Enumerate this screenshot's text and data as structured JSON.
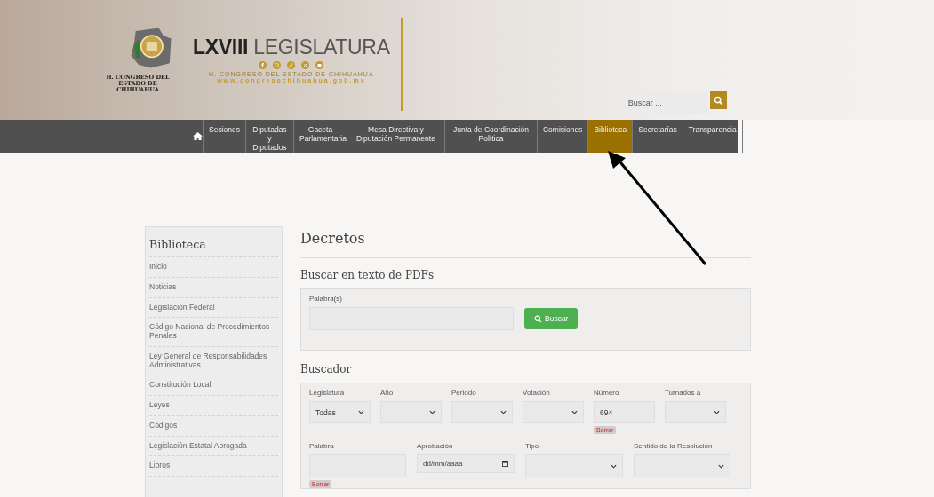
{
  "header": {
    "logo_caption": "H. CONGRESO DEL ESTADO DE CHIHUAHUA",
    "title_bold": "LXVIII",
    "title_rest": "LEGISLATURA",
    "subtitle": "H. CONGRESO DEL ESTADO DE CHIHUAHUA",
    "url": "www.congresochihuahua.gob.mx",
    "search": {
      "placeholder": "Buscar ..."
    }
  },
  "nav": [
    {
      "label": "Sesiones",
      "selected": false
    },
    {
      "label": "Diputadas y Diputados",
      "selected": false
    },
    {
      "label": "Gaceta Parlamentaria",
      "selected": false
    },
    {
      "label": "Mesa Directiva y Diputación Permanente",
      "selected": false
    },
    {
      "label": "Junta de Coordinación Política",
      "selected": false
    },
    {
      "label": "Comisiones",
      "selected": false
    },
    {
      "label": "Biblioteca",
      "selected": true
    },
    {
      "label": "Secretarías",
      "selected": false
    },
    {
      "label": "Transparencia",
      "selected": false
    }
  ],
  "sidebar": {
    "title": "Biblioteca",
    "items": [
      "Inicio",
      "Noticias",
      "Legislación Federal",
      "Código Nacional de Procedimientos Penales",
      "Ley General de Responsabilidades Administrativas",
      "Constitución Local",
      "Leyes",
      "Códigos",
      "Legislación Estatal Abrogada",
      "Libros"
    ]
  },
  "content": {
    "title": "Decretos",
    "pdf_search": {
      "heading": "Buscar en texto de PDFs",
      "label": "Palabra(s)",
      "button": "Buscar"
    },
    "finder": {
      "heading": "Buscador",
      "row1": [
        {
          "kind": "select",
          "label": "Legislatura",
          "value": "Todas"
        },
        {
          "kind": "select",
          "label": "Año"
        },
        {
          "kind": "select",
          "label": "Periodo"
        },
        {
          "kind": "select",
          "label": "Votación"
        },
        {
          "kind": "text",
          "label": "Número",
          "value": "694",
          "clear": "Borrar"
        },
        {
          "kind": "select",
          "label": "Turnados a"
        }
      ],
      "row2": [
        {
          "kind": "text",
          "label": "Palabra",
          "clear": "Borrar"
        },
        {
          "kind": "date",
          "label": "Aprobación",
          "placeholder": "dd/mm/aaaa"
        },
        {
          "kind": "select",
          "label": "Tipo"
        },
        {
          "kind": "select",
          "label": "Sentido de la Resolución"
        }
      ]
    }
  }
}
